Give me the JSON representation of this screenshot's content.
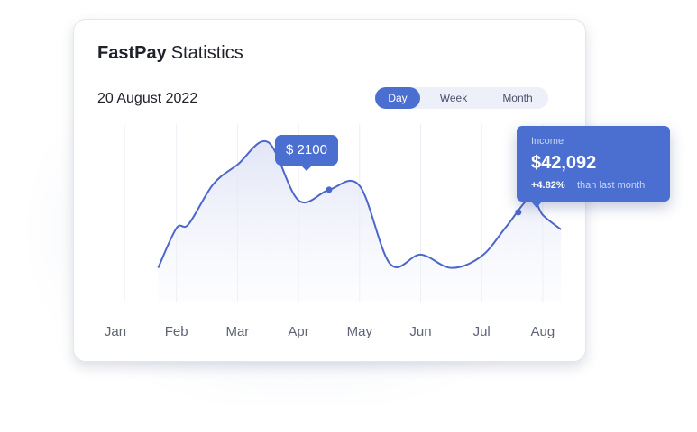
{
  "header": {
    "brand": "FastPay",
    "title_rest": "Statistics",
    "date": "20 August 2022"
  },
  "tabs": [
    {
      "label": "Day",
      "active": true
    },
    {
      "label": "Week",
      "active": false
    },
    {
      "label": "Month",
      "active": false
    }
  ],
  "highlight_bubble": "$ 2100",
  "income_card": {
    "label": "Income",
    "value": "$42,092",
    "change": "+4.82%",
    "comparison": "than last month"
  },
  "colors": {
    "accent": "#4a6fd1",
    "line": "#4b67c9",
    "text": "#20222b"
  },
  "chart_data": {
    "type": "area",
    "categories": [
      "Jan",
      "Feb",
      "Mar",
      "Apr",
      "May",
      "Jun",
      "Jul",
      "Aug"
    ],
    "x": [
      0.7,
      1.0,
      1.2,
      1.6,
      2.0,
      2.5,
      3.0,
      3.5,
      4.0,
      4.5,
      5.0,
      5.5,
      6.0,
      6.4,
      6.8,
      7.0,
      7.3
    ],
    "values": [
      0.05,
      0.35,
      0.38,
      0.68,
      0.83,
      1.0,
      0.56,
      0.64,
      0.67,
      0.08,
      0.15,
      0.05,
      0.14,
      0.36,
      0.58,
      0.45,
      0.34
    ],
    "markers": [
      {
        "x": 3.5,
        "label": "$ 2100"
      },
      {
        "x": 6.6,
        "label": "$42,092"
      }
    ],
    "ylim": [
      0,
      1.1
    ],
    "grid": "vertical",
    "xlabel": "",
    "ylabel": ""
  }
}
